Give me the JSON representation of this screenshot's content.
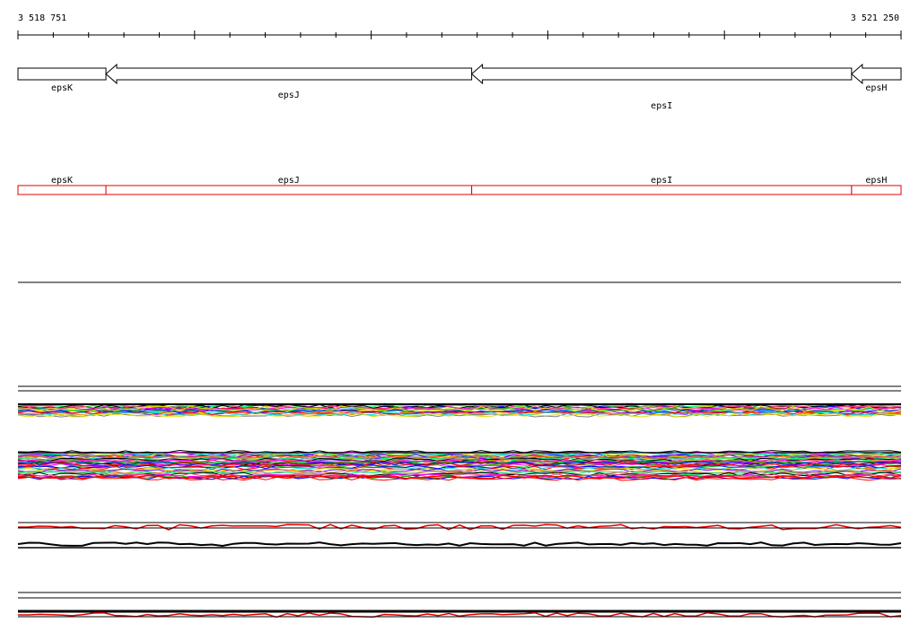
{
  "region": {
    "start_label": "3 518 751",
    "end_label": "3 521 250",
    "start": 3518751,
    "end": 3521250
  },
  "genes": [
    {
      "name": "epsK",
      "start": 3518751,
      "end": 3519000,
      "strand": "-",
      "label_row": 0
    },
    {
      "name": "epsJ",
      "start": 3519000,
      "end": 3520035,
      "strand": "-",
      "label_row": 1
    },
    {
      "name": "epsI",
      "start": 3520035,
      "end": 3521110,
      "strand": "-",
      "label_row": 2
    },
    {
      "name": "epsH",
      "start": 3521110,
      "end": 3521250,
      "strand": "-",
      "label_row": 0
    }
  ],
  "colors": {
    "gene_outline": "#000000",
    "feature_outline": "#e00000",
    "ruler": "#000000",
    "track_line": "#000000"
  },
  "signal_palette": [
    "#ff00ff",
    "#00c000",
    "#0000ff",
    "#ff0000",
    "#00e0e0",
    "#e0e000",
    "#8000ff",
    "#ff8000",
    "#808080",
    "#00ff80",
    "#000000",
    "#ff4080"
  ]
}
